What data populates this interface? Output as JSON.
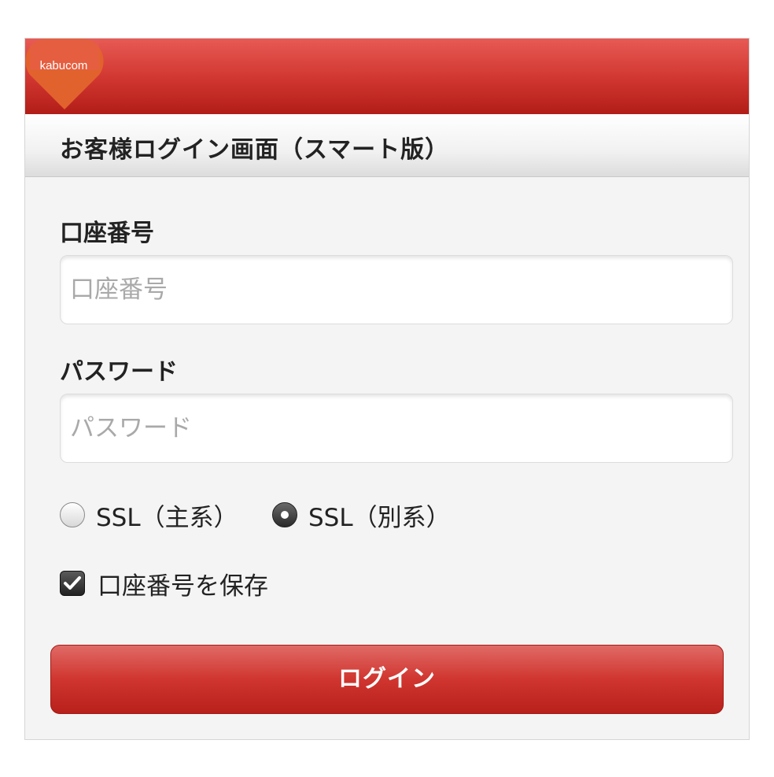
{
  "header": {
    "logo_text": "kabucom"
  },
  "page": {
    "title": "お客様ログイン画面（スマート版）"
  },
  "form": {
    "account": {
      "label": "口座番号",
      "placeholder": "口座番号",
      "value": ""
    },
    "password": {
      "label": "パスワード",
      "placeholder": "パスワード",
      "value": ""
    },
    "ssl_options": [
      {
        "label": "SSL（主系）",
        "selected": false
      },
      {
        "label": "SSL（別系）",
        "selected": true
      }
    ],
    "remember": {
      "label": "口座番号を保存",
      "checked": true
    },
    "submit_label": "ログイン"
  },
  "colors": {
    "brand_red": "#d0352f",
    "logo_orange": "#e2622e"
  },
  "icons": {
    "logo": "heart-logo-icon",
    "checkmark": "checkmark-icon"
  }
}
